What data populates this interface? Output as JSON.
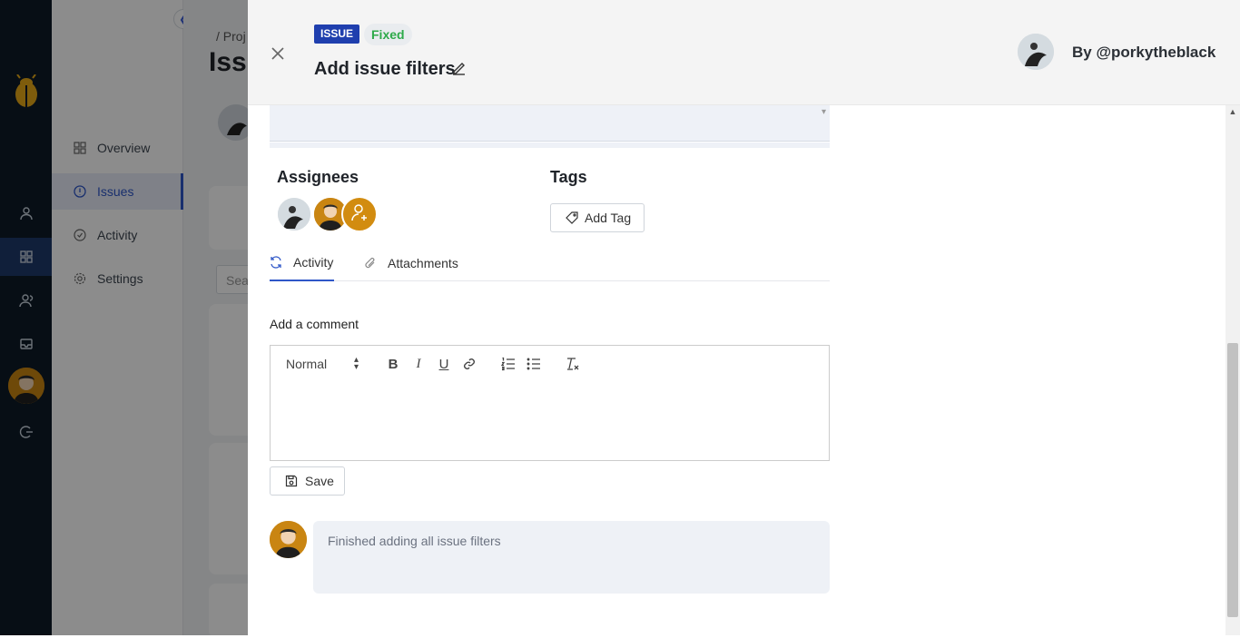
{
  "sidebar": {
    "items": [
      {
        "label": "Overview",
        "icon": "grid-icon"
      },
      {
        "label": "Issues",
        "icon": "alert-circle-icon",
        "active": true
      },
      {
        "label": "Activity",
        "icon": "check-circle-icon"
      },
      {
        "label": "Settings",
        "icon": "gear-icon"
      }
    ]
  },
  "background": {
    "breadcrumb": "/  Proj",
    "page_title": "Issu",
    "search_placeholder": "Sea"
  },
  "drawer": {
    "type_badge": "ISSUE",
    "status_badge": "Fixed",
    "title": "Add issue filters",
    "author": "By @porkytheblack",
    "assignees_label": "Assignees",
    "tags_label": "Tags",
    "add_tag_label": "Add Tag",
    "tabs": [
      {
        "label": "Activity",
        "active": true
      },
      {
        "label": "Attachments",
        "active": false
      }
    ],
    "comment_label": "Add a comment",
    "editor": {
      "format_value": "Normal"
    },
    "save_label": "Save",
    "comments": [
      {
        "text": "Finished adding all issue filters"
      }
    ]
  },
  "colors": {
    "rail": "#0e1a27",
    "accent": "#2f57c8",
    "badge_type": "#1f3fae",
    "status_green": "#2eaa4a",
    "avatar_orange": "#c98512"
  }
}
